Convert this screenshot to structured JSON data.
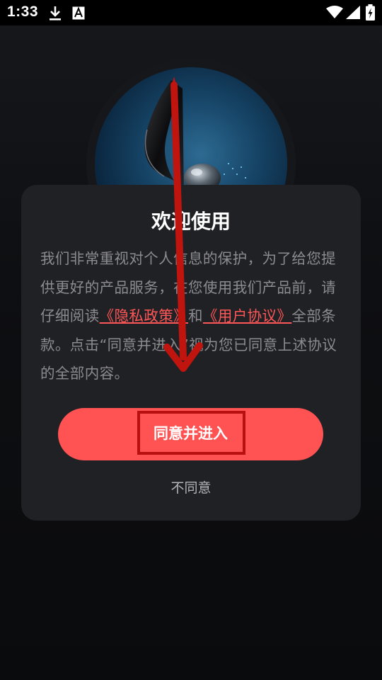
{
  "status_bar": {
    "time": "1:33",
    "icons": [
      "download-icon",
      "font-a-icon",
      "wifi-icon",
      "signal-icon",
      "battery-charging-icon"
    ]
  },
  "background": {
    "artwork": "music-note-disc"
  },
  "dialog": {
    "title": "欢迎使用",
    "body_part1": "我们非常重视对个人信息的保护，为了给您提供更好的产品服务，在您使用我们产品前，请仔细阅读",
    "privacy_link": "《隐私政策》",
    "body_and": "和",
    "terms_link": "《用户协议》",
    "body_part2": "全部条款。点击“同意并进入”视为您已同意上述协议的全部内容。",
    "agree_label": "同意并进入",
    "disagree_label": "不同意"
  },
  "colors": {
    "accent": "#ff5252",
    "link": "#ff5757",
    "annotation": "#b81010"
  }
}
